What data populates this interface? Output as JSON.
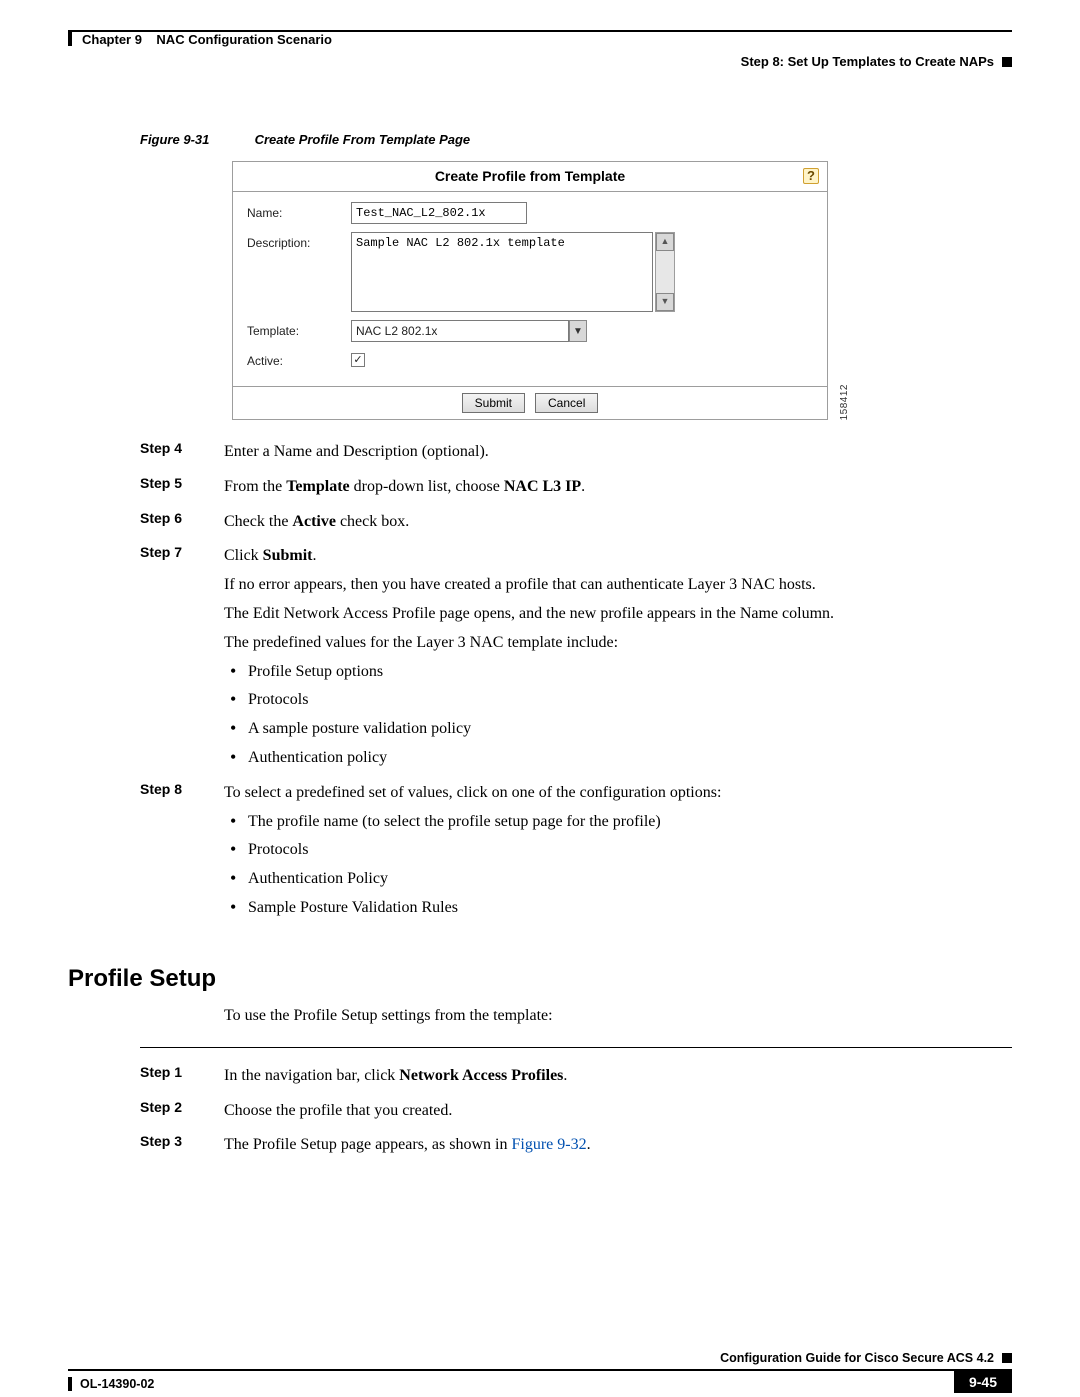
{
  "header": {
    "chapter": "Chapter 9",
    "chapter_title": "NAC Configuration Scenario",
    "step_title": "Step 8: Set Up Templates to Create NAPs"
  },
  "figure": {
    "label": "Figure 9-31",
    "title": "Create Profile From Template Page",
    "id_vert": "158412"
  },
  "form": {
    "panel_title": "Create Profile from Template",
    "labels": {
      "name": "Name:",
      "description": "Description:",
      "template": "Template:",
      "active": "Active:"
    },
    "name_value": "Test_NAC_L2_802.1x",
    "description_value": "Sample NAC L2 802.1x template",
    "template_value": "NAC L2 802.1x",
    "active_check": "✓",
    "buttons": {
      "submit": "Submit",
      "cancel": "Cancel"
    },
    "help": "?"
  },
  "steps_a": [
    {
      "label": "Step 4",
      "lines": [
        "Enter a Name and Description (optional)."
      ]
    },
    {
      "label": "Step 5",
      "pre": "From the ",
      "b1": "Template",
      "mid": " drop-down list, choose ",
      "b2": "NAC L3 IP",
      "post": "."
    },
    {
      "label": "Step 6",
      "pre": "Check the ",
      "b1": "Active",
      "post": " check box."
    },
    {
      "label": "Step 7",
      "pre": "Click ",
      "b1": "Submit",
      "post": ".",
      "extra": [
        "If no error appears, then you have created a profile that can authenticate Layer 3 NAC hosts.",
        "The Edit Network Access Profile page opens, and the new profile appears in the Name column.",
        "The predefined values for the Layer 3 NAC template include:"
      ],
      "bullets": [
        "Profile Setup options",
        "Protocols",
        "A sample posture validation policy",
        "Authentication policy"
      ]
    },
    {
      "label": "Step 8",
      "lines": [
        "To select a predefined set of values, click on one of the configuration options:"
      ],
      "bullets": [
        "The profile name (to select the profile setup page for the profile)",
        "Protocols",
        "Authentication Policy",
        "Sample Posture Validation Rules"
      ]
    }
  ],
  "section": {
    "heading": "Profile Setup",
    "lead": "To use the Profile Setup settings from the template:"
  },
  "steps_b": [
    {
      "label": "Step 1",
      "pre": "In the navigation bar, click ",
      "b1": "Network Access Profiles",
      "post": "."
    },
    {
      "label": "Step 2",
      "lines": [
        "Choose the profile that you created."
      ]
    },
    {
      "label": "Step 3",
      "pre": "The Profile Setup page appears, as shown in ",
      "xref": "Figure 9-32",
      "post": "."
    }
  ],
  "footer": {
    "guide": "Configuration Guide for Cisco Secure ACS 4.2",
    "docnum": "OL-14390-02",
    "pagenum": "9-45"
  }
}
